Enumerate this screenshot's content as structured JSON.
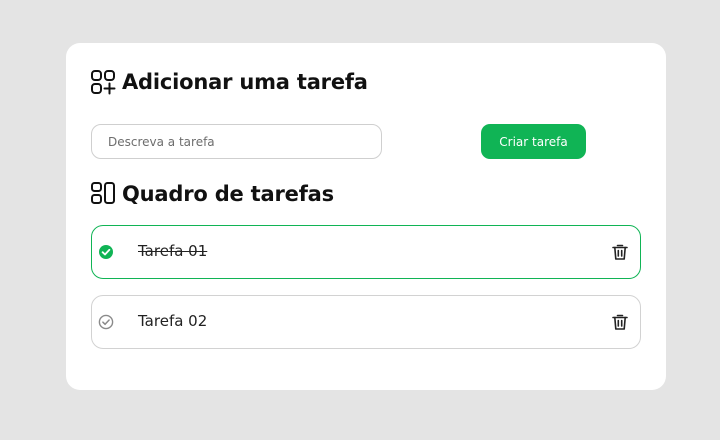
{
  "add_section": {
    "title": "Adicionar uma tarefa",
    "icon": "add-squares-icon"
  },
  "form": {
    "input_value": "",
    "input_placeholder": "Descreva a tarefa",
    "create_button_label": "Criar tarefa"
  },
  "board_section": {
    "title": "Quadro de tarefas",
    "icon": "board-icon"
  },
  "tasks": [
    {
      "label": "Tarefa 01",
      "completed": true,
      "status_icon": "check-circle-filled-icon",
      "delete_icon": "trash-icon"
    },
    {
      "label": "Tarefa 02",
      "completed": false,
      "status_icon": "check-circle-outline-icon",
      "delete_icon": "trash-icon"
    }
  ],
  "colors": {
    "background": "#e4e4e4",
    "card": "#ffffff",
    "accent": "#10b455",
    "border": "#d2d2d2",
    "text": "#111111",
    "muted_icon": "#8a8a8a"
  }
}
